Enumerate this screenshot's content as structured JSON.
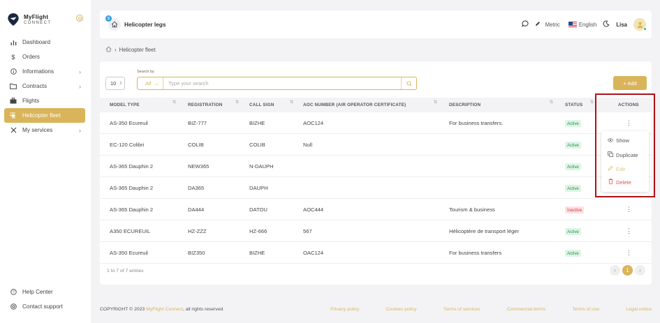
{
  "app": {
    "brand_line1": "MyFlight",
    "brand_line2": "CONNECT",
    "accent": "#d9b45a"
  },
  "sidebar": {
    "items": [
      {
        "label": "Dashboard",
        "icon": "bar-chart-icon",
        "chevron": false
      },
      {
        "label": "Orders",
        "icon": "dollar-icon",
        "chevron": false
      },
      {
        "label": "Informations",
        "icon": "info-icon",
        "chevron": true
      },
      {
        "label": "Contracts",
        "icon": "folder-icon",
        "chevron": true
      },
      {
        "label": "Flights",
        "icon": "briefcase-icon",
        "chevron": false
      },
      {
        "label": "Helicopter fleet",
        "icon": "helicopter-icon",
        "chevron": false,
        "active": true
      },
      {
        "label": "My services",
        "icon": "tools-icon",
        "chevron": true
      }
    ],
    "bottom": [
      {
        "label": "Help Center",
        "icon": "help-icon"
      },
      {
        "label": "Contact support",
        "icon": "support-icon"
      }
    ]
  },
  "header": {
    "badge": "5",
    "title": "Helicopter legs",
    "metric": "Metric",
    "language": "English",
    "user": "Lisa"
  },
  "breadcrumb": {
    "current": "Helicopter fleet"
  },
  "toolbar": {
    "page_size": "10",
    "search_label": "Search by",
    "search_filter": "All",
    "search_placeholder": "Type your search",
    "add_label": "+ Add"
  },
  "table": {
    "columns": [
      "MODEL TYPE",
      "REGISTRATION",
      "CALL SIGN",
      "AOC NUMBER (AIR OPERATOR CERTIFICATE)",
      "DESCRIPTION",
      "STATUS",
      "ACTIONS"
    ],
    "rows": [
      {
        "model": "AS-350 Ecureuil",
        "registration": "BIZ-777",
        "callsign": "BIZHE",
        "aoc": "AOC124",
        "description": "For business transfers.",
        "status": "Active"
      },
      {
        "model": "EC-120 Colibri",
        "registration": "COLIB",
        "callsign": "COLIB",
        "aoc": "Null",
        "description": "",
        "status": "Active"
      },
      {
        "model": "AS-365 Dauphin 2",
        "registration": "NEW365",
        "callsign": "N-DAUPH",
        "aoc": "",
        "description": "",
        "status": "Active"
      },
      {
        "model": "AS-365 Dauphin 2",
        "registration": "DA365",
        "callsign": "DAUPH",
        "aoc": "",
        "description": "",
        "status": "Active"
      },
      {
        "model": "AS-365 Dauphin 2",
        "registration": "DA444",
        "callsign": "DATOU",
        "aoc": "AOC444",
        "description": "Tourism & business",
        "status": "Inactive"
      },
      {
        "model": "A350 ECUREUIL",
        "registration": "HZ-ZZZ",
        "callsign": "HZ-666",
        "aoc": "567",
        "description": "Hélicoptère de transport léger",
        "status": "Active"
      },
      {
        "model": "AS-350 Ecureuil",
        "registration": "BIZ350",
        "callsign": "BIZHE",
        "aoc": "OAC124",
        "description": "For business transfers",
        "status": "Active"
      }
    ],
    "entries": "1 to 7 of 7 entries",
    "page": "1"
  },
  "actions_menu": {
    "show": "Show",
    "duplicate": "Duplicate",
    "edit": "Edit",
    "delete": "Delete"
  },
  "footer": {
    "copyright": "COPYRIGHT © 2023 ",
    "brand": "MyFlight Connect",
    "rights": ", all rights reserved",
    "links": [
      "Privacy policy",
      "Cookies policy",
      "Terms of services",
      "Commercial terms",
      "Terms of use",
      "Legal notice"
    ]
  }
}
